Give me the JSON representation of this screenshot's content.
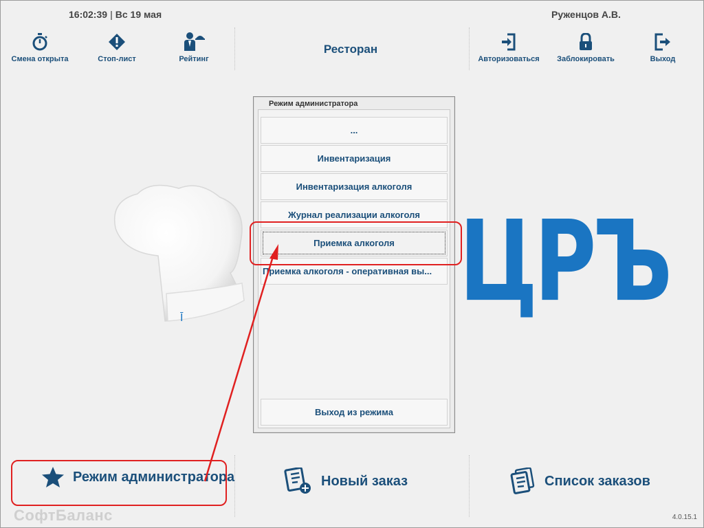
{
  "header": {
    "time": "16:02:39",
    "date": "Вс 19 мая",
    "user": "Руженцов А.В.",
    "title": "Ресторан"
  },
  "toolbar": {
    "shift": "Смена открыта",
    "stoplist": "Стоп-лист",
    "rating": "Рейтинг",
    "login": "Авторизоваться",
    "lock": "Заблокировать",
    "exit": "Выход"
  },
  "brand": {
    "logo_text": "ЦРЪ"
  },
  "admin_dialog": {
    "title": "Режим администратора",
    "items": [
      "...",
      "Инвентаризация",
      "Инвентаризация алкоголя",
      "Журнал реализации алкоголя",
      "Приемка алкоголя",
      "Приемка алкоголя - оперативная вы..."
    ],
    "selected": "Приемка алкоголя",
    "exit_mode": "Выход из режима"
  },
  "bottom": {
    "admin_mode": "Режим администратора",
    "new_order": "Новый заказ",
    "order_list": "Список заказов"
  },
  "footer": {
    "company": "СофтБаланс",
    "version": "4.0.15.1"
  },
  "colors": {
    "accent": "#1b4f7a",
    "logo": "#1a75c2",
    "highlight": "#e02020"
  }
}
